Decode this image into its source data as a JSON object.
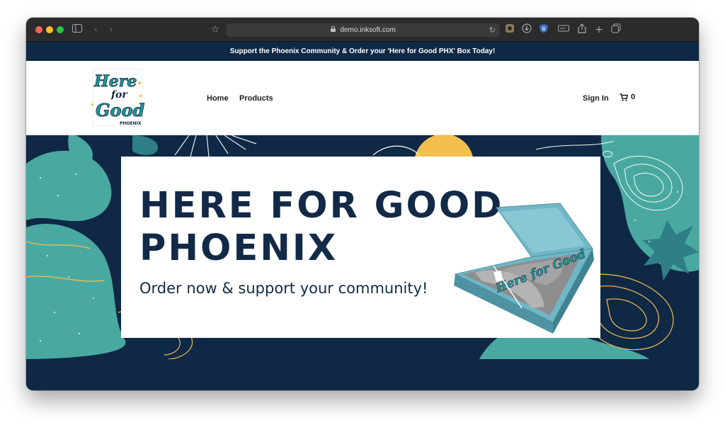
{
  "browser": {
    "url": "demo.inksoft.com",
    "icons": [
      "sidebar-icon",
      "back-icon",
      "forward-icon",
      "bookmark-star-icon",
      "lock-icon",
      "reload-icon",
      "extension-icon",
      "download-icon",
      "shield-extension-icon",
      "password-icon",
      "share-icon",
      "new-tab-icon",
      "tabs-overview-icon"
    ]
  },
  "announcement": {
    "text": "Support the Phoenix Community & Order your 'Here for Good PHX' Box Today!"
  },
  "header": {
    "logo": {
      "line1": "Here",
      "line2": "for",
      "line3": "Good",
      "line4": "PHOENIX"
    },
    "nav": [
      {
        "label": "Home"
      },
      {
        "label": "Products"
      }
    ],
    "sign_in": "Sign In",
    "cart_count": "0"
  },
  "hero": {
    "title_line1": "HERE FOR GOOD",
    "title_line2": "PHOENIX",
    "subtitle": "Order now & support your community!",
    "box_text": "Here for Good"
  },
  "colors": {
    "navy": "#0f2846",
    "teal": "#49a9a0",
    "gold": "#f3c04e",
    "box_blue": "#6fb6c6"
  }
}
